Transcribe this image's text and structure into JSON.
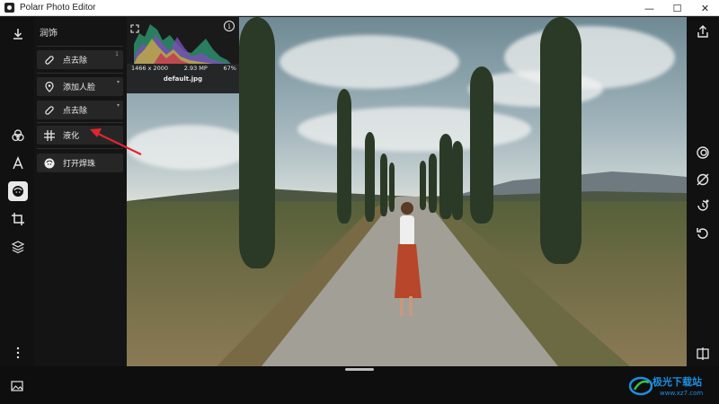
{
  "window": {
    "title": "Polarr Photo Editor",
    "controls": {
      "minimize": "—",
      "maximize": "☐",
      "close": "✕"
    }
  },
  "panel": {
    "title": "润饰",
    "tools": [
      {
        "label": "点去除",
        "badge": "1",
        "icon": "bandage-icon"
      },
      {
        "label": "添加人脸",
        "badge": "▾",
        "icon": "location-pin-icon"
      },
      {
        "label": "点去除",
        "badge": "▾",
        "icon": "bandage-icon"
      },
      {
        "label": "液化",
        "badge": "",
        "icon": "grid-icon"
      },
      {
        "label": "打开焊珠",
        "badge": "",
        "icon": "face-icon"
      }
    ]
  },
  "histogram": {
    "dimensions": "1466 x 2000",
    "megapixels": "2.93 MP",
    "zoom": "67%",
    "filename": "default.jpg"
  },
  "watermark": {
    "name": "极光下载站",
    "url": "www.xz7.com"
  },
  "colors": {
    "accent_arrow": "#e0262d",
    "watermark_blue": "#1d8fe2"
  }
}
